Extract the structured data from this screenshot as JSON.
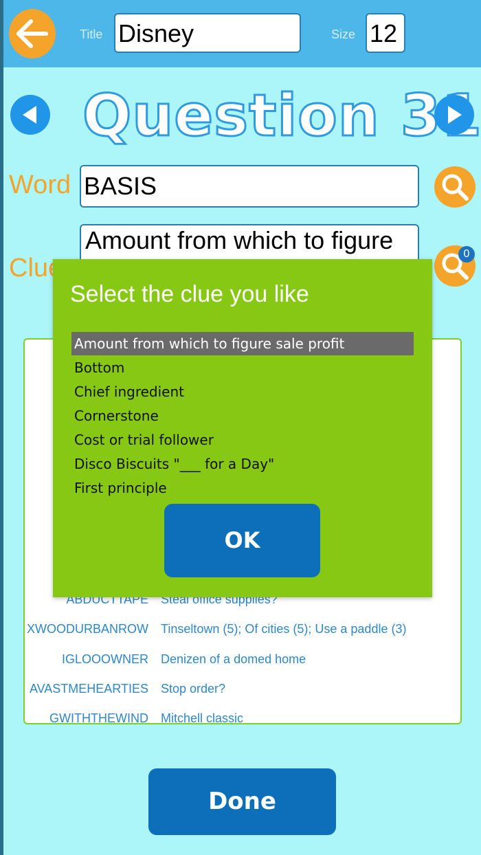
{
  "header": {
    "title_label": "Title",
    "title_value": "Disney",
    "size_label": "Size",
    "size_value": "12"
  },
  "question": {
    "heading": "Question 31"
  },
  "word": {
    "label": "Word",
    "value": "BASIS"
  },
  "clue": {
    "label": "Clue",
    "value": "Amount from which to figure",
    "badge_count": "0"
  },
  "list": {
    "rows": [
      {
        "answer": "ABDUCTTAPE",
        "clue": "Steal office supplies?"
      },
      {
        "answer": "XWOODURBANROW",
        "clue": "Tinseltown (5); Of cities (5); Use a paddle (3)"
      },
      {
        "answer": "IGLOOOWNER",
        "clue": "Denizen of a domed home"
      },
      {
        "answer": "AVASTMEHEARTIES",
        "clue": "Stop order?"
      },
      {
        "answer": "GWITHTHEWIND",
        "clue": "Mitchell classic"
      }
    ]
  },
  "dialog": {
    "title": "Select the clue you like",
    "options": [
      "Amount from which to figure sale profit",
      "Bottom",
      "Chief ingredient",
      "Cornerstone",
      "Cost or trial follower",
      "Disco Biscuits \"___ for a Day\"",
      "First principle"
    ],
    "selected_index": 0,
    "ok_label": "OK"
  },
  "footer": {
    "done_label": "Done"
  },
  "colors": {
    "background": "#acf6fa",
    "header": "#4db7ea",
    "accent_orange": "#f4a42b",
    "dialog_green": "#86c814",
    "button_blue": "#0d6fba"
  }
}
